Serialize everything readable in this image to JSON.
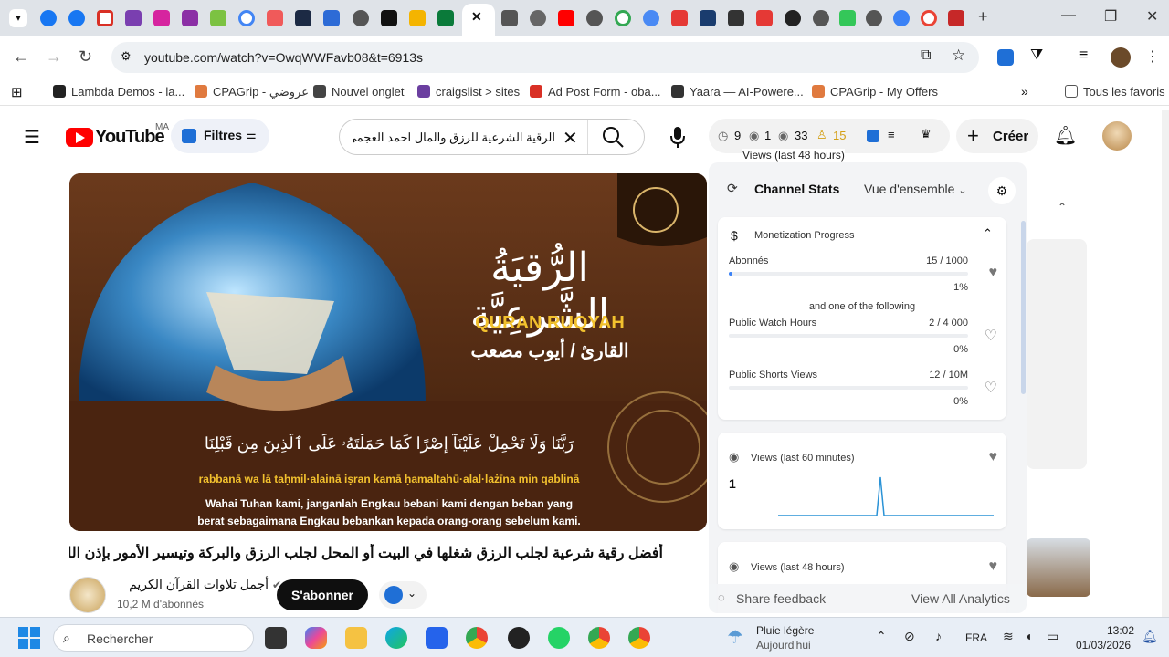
{
  "browser": {
    "url": "youtube.com/watch?v=OwqWWFavb08&t=6913s",
    "bookmarks": [
      {
        "label": "Lambda Demos - la...",
        "color": "#222222"
      },
      {
        "label": "CPAGrip - عروضي",
        "color": "#e07a3f"
      },
      {
        "label": "Nouvel onglet",
        "color": "#444444"
      },
      {
        "label": "craigslist > sites",
        "color": "#6b3fa0"
      },
      {
        "label": "Ad Post Form - oba...",
        "color": "#d93025"
      },
      {
        "label": "Yaara — AI-Powere...",
        "color": "#333333"
      },
      {
        "label": "CPAGrip - My Offers",
        "color": "#e07a3f"
      }
    ],
    "all_bookmarks": "Tous les favoris"
  },
  "youtube": {
    "logo": "YouTube",
    "region": "MA",
    "filters_label": "Filtres",
    "search_query": "الرقية الشرعية للرزق والمال احمد العجمي",
    "counters": {
      "c1": "9",
      "c2": "1",
      "c3": "33",
      "c4": "15"
    },
    "tooltip": "Views (last 48 hours)",
    "create_label": "Créer"
  },
  "video": {
    "thumb_title_ar": "الرُّقيَةُ الشَّرعِيَّة",
    "quran_ruqyah": "QURAN RUQYAH",
    "reciter": "القارئ / أيوب مصعب",
    "verse_ar": "رَبَّنَا وَلَا تَحْمِلْ عَلَيْنَآ إِصْرًا كَمَا حَمَلْتَهُۥ عَلَى ٱلَّذِينَ مِن قَبْلِنَا",
    "translit": "rabbanā wa lā taḥmil·alainā iṣran kamā ḥamaltahū·alal·lażīna min qablinā",
    "translation_1": "Wahai Tuhan kami, janganlah Engkau bebani kami dengan beban yang",
    "translation_2": "berat sebagaimana Engkau bebankan kepada orang-orang sebelum kami.",
    "title": "أفضل رقية شرعية لجلب الرزق شغلها في البيت أو المحل لجلب الرزق والبركة وتيسير الأمور بإذن الله",
    "channel_name": "أجمل تلاوات القرآن الكريم",
    "subscribers": "10,2 M d'abonnés",
    "subscribe_label": "S'abonner"
  },
  "panel": {
    "title": "Channel Stats",
    "view_select": "Vue d'ensemble",
    "monetization": {
      "title": "Monetization Progress",
      "abonnes_label": "Abonnés",
      "abonnes_value": "15 / 1000",
      "abonnes_pct": "1%",
      "abonnes_fill": 0.015,
      "separator": "and one of the following",
      "watch_label": "Public Watch Hours",
      "watch_value": "2 / 4 000",
      "watch_pct": "0%",
      "shorts_label": "Public Shorts Views",
      "shorts_value": "12 / 10M",
      "shorts_pct": "0%"
    },
    "views60": {
      "title": "Views (last 60 minutes)",
      "value": "1"
    },
    "views48": {
      "title": "Views (last 48 hours)"
    },
    "feedback": "Share feedback",
    "analytics": "View All Analytics"
  },
  "taskbar": {
    "search_placeholder": "Rechercher",
    "weather_title": "Pluie légère",
    "weather_sub": "Aujourd'hui",
    "lang": "FRA",
    "time": "13:02",
    "date": "01/03/2026"
  }
}
